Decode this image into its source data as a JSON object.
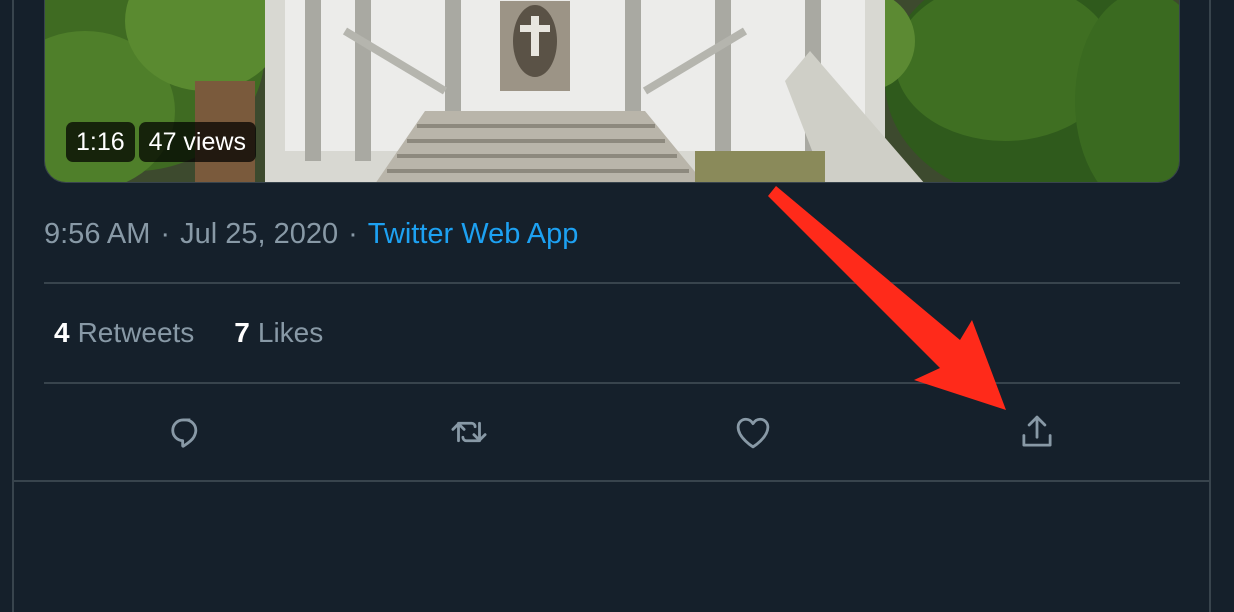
{
  "media": {
    "duration": "1:16",
    "views": "47 views"
  },
  "meta": {
    "time": "9:56 AM",
    "separator": "·",
    "date": "Jul 25, 2020",
    "source": "Twitter Web App"
  },
  "stats": {
    "retweets_count": "4",
    "retweets_label": "Retweets",
    "likes_count": "7",
    "likes_label": "Likes"
  },
  "actions": [
    {
      "name": "reply",
      "icon": "reply-icon"
    },
    {
      "name": "retweet",
      "icon": "retweet-icon"
    },
    {
      "name": "like",
      "icon": "heart-icon"
    },
    {
      "name": "share",
      "icon": "share-icon"
    }
  ],
  "colors": {
    "background": "#15202b",
    "border": "#38444d",
    "text_secondary": "#8899a6",
    "link": "#1da1f2",
    "annotation_arrow": "#ff2a1a"
  }
}
